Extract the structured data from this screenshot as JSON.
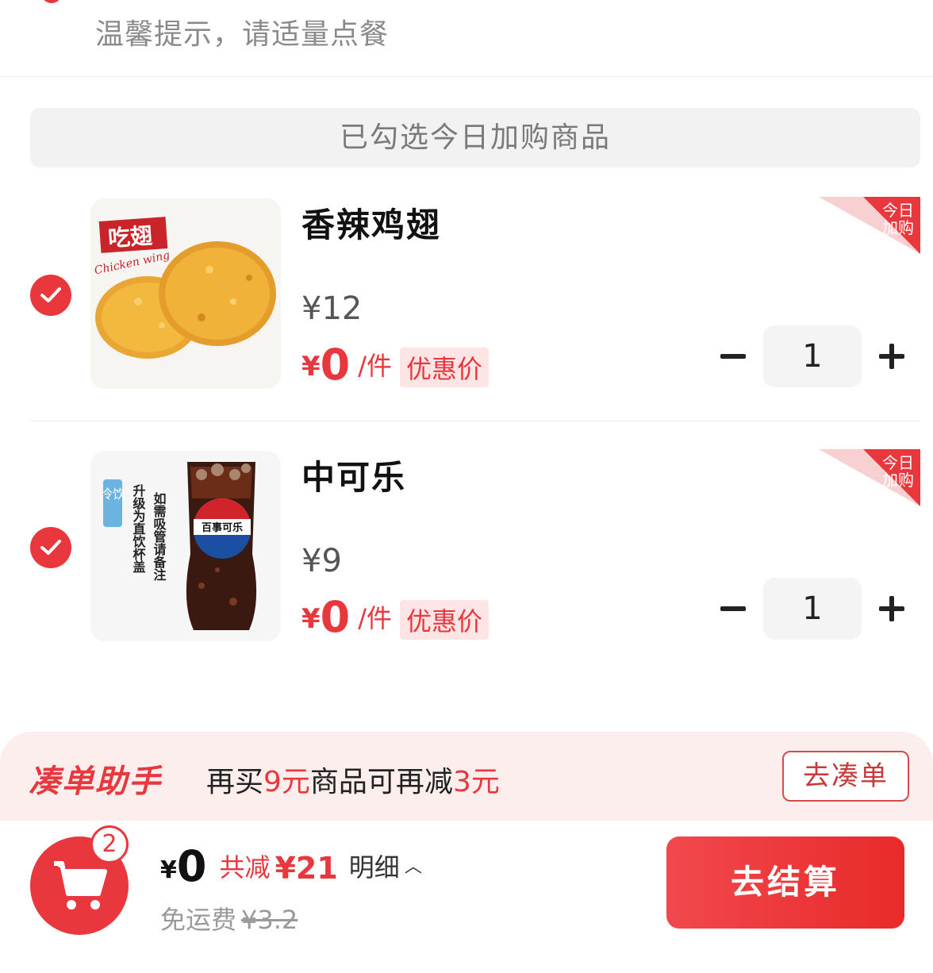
{
  "tip": {
    "text": "温馨提示，请适量点餐"
  },
  "section": {
    "title": "已勾选今日加购商品"
  },
  "items": [
    {
      "name": "香辣鸡翅",
      "original_price": "¥12",
      "deal_currency": "¥",
      "deal_amount": "0",
      "unit": "/件",
      "badge": "优惠价",
      "tag": "今日加购",
      "quantity": "1",
      "image_caption": "吃翅",
      "image_subcaption": "Chicken wing",
      "checked": true
    },
    {
      "name": "中可乐",
      "original_price": "¥9",
      "deal_currency": "¥",
      "deal_amount": "0",
      "unit": "/件",
      "badge": "优惠价",
      "tag": "今日加购",
      "quantity": "1",
      "image_caption": "冷饮",
      "image_note_1": "如需吸管请备注",
      "image_note_2": "升级为直饮杯盖",
      "image_brand": "百事可乐",
      "checked": true
    }
  ],
  "helper": {
    "logo": "凑单助手",
    "msg_prefix": "再买",
    "msg_amount": "9元",
    "msg_middle": "商品可再减",
    "msg_discount": "3元",
    "button": "去凑单"
  },
  "footer": {
    "cart_count": "2",
    "currency": "¥",
    "total": "0",
    "saved_label": "共减",
    "saved_amount": "¥21",
    "detail_label": "明细",
    "shipping_label": "免运费",
    "shipping_original": "¥3.2",
    "checkout": "去结算"
  },
  "colors": {
    "accent": "#e8383d",
    "badge_bg": "#fde5e6",
    "helper_bg": "#fdeeee"
  }
}
